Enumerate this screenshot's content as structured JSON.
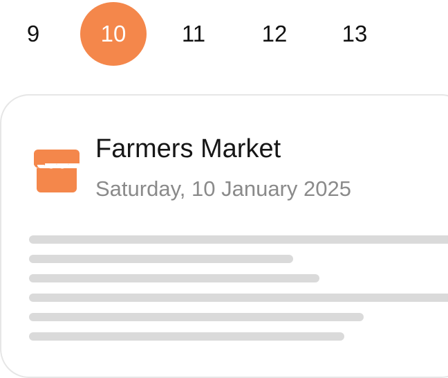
{
  "date_strip": {
    "days": [
      "9",
      "10",
      "11",
      "12",
      "13"
    ],
    "selected": "10"
  },
  "event": {
    "title": "Farmers Market",
    "date": "Saturday, 10 January 2025",
    "icon": "storefront-icon"
  },
  "colors": {
    "accent": "#F4874B",
    "placeholder": "#DADADA",
    "secondary_text": "#8A8A8A",
    "card_border": "#E6E6E6"
  }
}
